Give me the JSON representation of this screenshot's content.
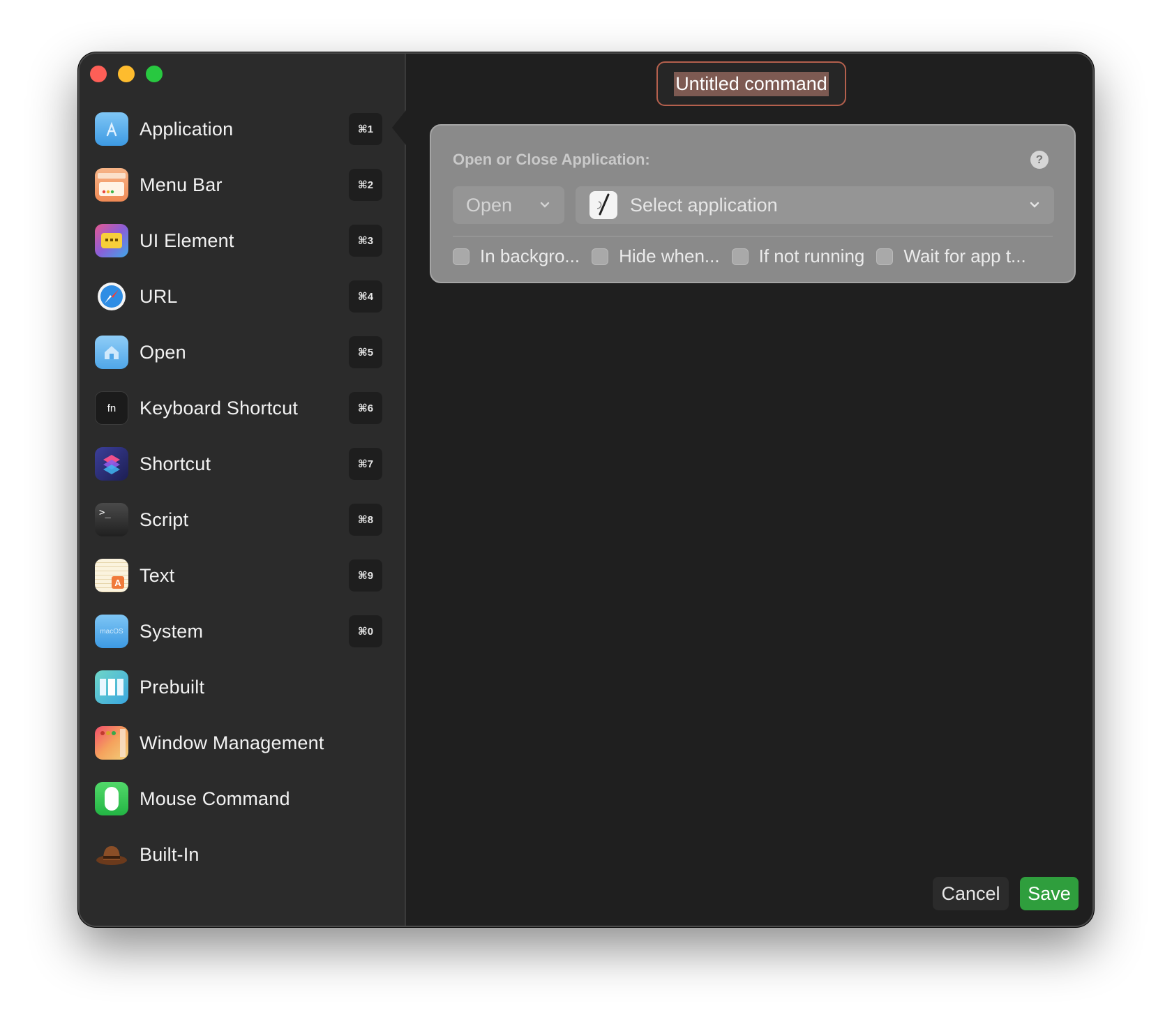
{
  "title_field": {
    "value": "Untitled command"
  },
  "sidebar": {
    "items": [
      {
        "label": "Application",
        "shortcut": "⌘1",
        "icon": "app-store-folder-icon"
      },
      {
        "label": "Menu Bar",
        "shortcut": "⌘2",
        "icon": "menu-bar-icon"
      },
      {
        "label": "UI Element",
        "shortcut": "⌘3",
        "icon": "ui-element-icon"
      },
      {
        "label": "URL",
        "shortcut": "⌘4",
        "icon": "safari-compass-icon"
      },
      {
        "label": "Open",
        "shortcut": "⌘5",
        "icon": "home-folder-icon"
      },
      {
        "label": "Keyboard Shortcut",
        "shortcut": "⌘6",
        "icon": "fn-key-icon",
        "icon_text": "fn"
      },
      {
        "label": "Shortcut",
        "shortcut": "⌘7",
        "icon": "shortcuts-app-icon"
      },
      {
        "label": "Script",
        "shortcut": "⌘8",
        "icon": "terminal-icon",
        "icon_text": ">_"
      },
      {
        "label": "Text",
        "shortcut": "⌘9",
        "icon": "text-edit-icon",
        "icon_text": "A"
      },
      {
        "label": "System",
        "shortcut": "⌘0",
        "icon": "macos-folder-icon",
        "icon_text": "macOS"
      },
      {
        "label": "Prebuilt",
        "shortcut": "",
        "icon": "prebuilt-layout-icon"
      },
      {
        "label": "Window Management",
        "shortcut": "",
        "icon": "window-management-icon"
      },
      {
        "label": "Mouse Command",
        "shortcut": "",
        "icon": "mouse-icon"
      },
      {
        "label": "Built-In",
        "shortcut": "",
        "icon": "hat-icon"
      }
    ]
  },
  "panel": {
    "title": "Open or Close Application:",
    "help": "?",
    "action_dropdown": {
      "value": "Open"
    },
    "app_dropdown": {
      "value": "Select application"
    },
    "options": [
      {
        "label": "In backgro...",
        "checked": false
      },
      {
        "label": "Hide when...",
        "checked": false
      },
      {
        "label": "If not running",
        "checked": false
      },
      {
        "label": "Wait for app t...",
        "checked": false
      }
    ]
  },
  "footer": {
    "cancel_label": "Cancel",
    "save_label": "Save"
  },
  "colors": {
    "save_button": "#2f9e3d",
    "title_field_border": "#b4604d",
    "panel_bg": "#8a8a8a"
  }
}
